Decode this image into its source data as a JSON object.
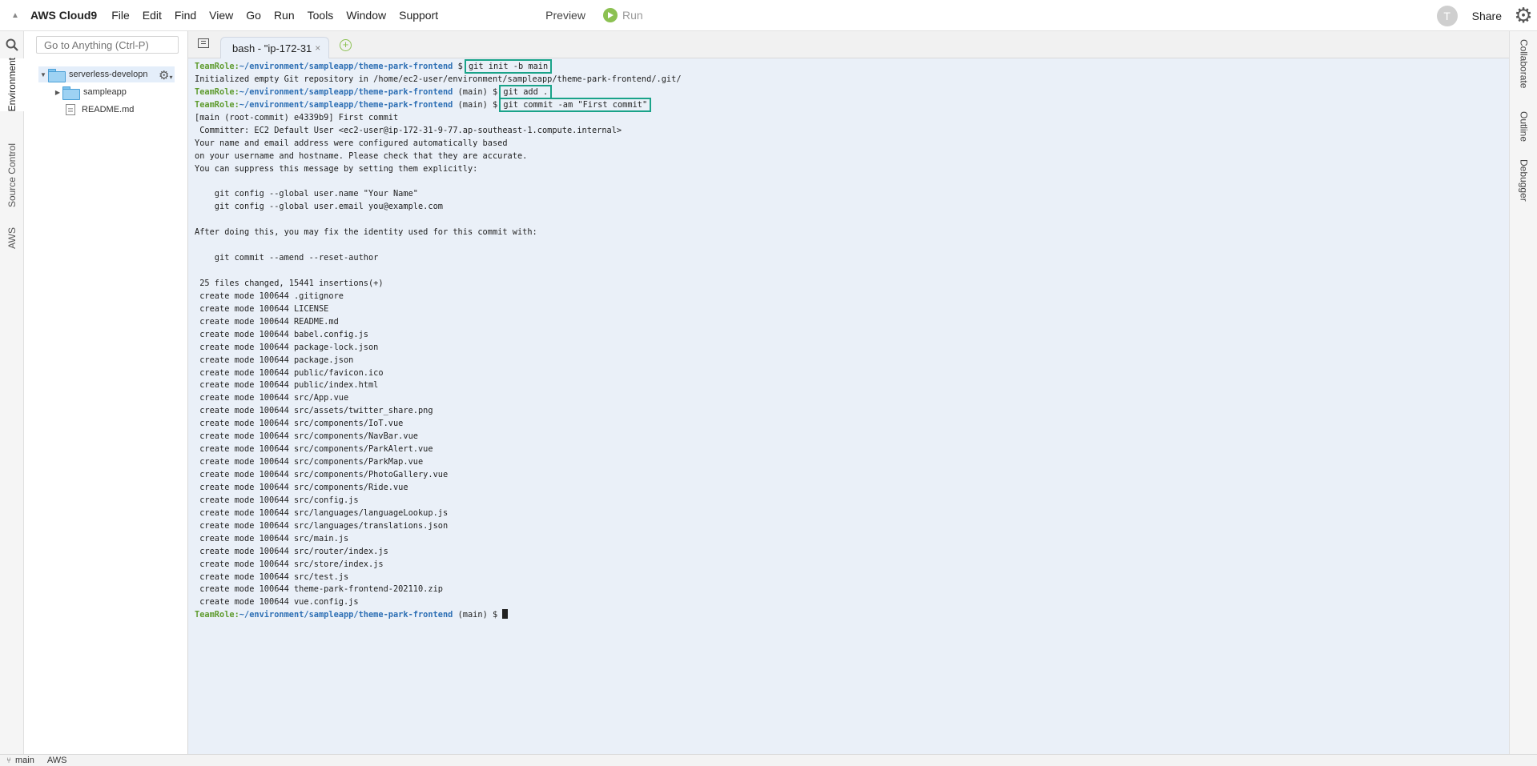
{
  "menubar": {
    "brand": "AWS Cloud9",
    "menus": [
      "File",
      "Edit",
      "Find",
      "View",
      "Go",
      "Run",
      "Tools",
      "Window",
      "Support"
    ],
    "preview": "Preview",
    "run": "Run",
    "avatar_letter": "T",
    "share": "Share"
  },
  "left_tabs": [
    "Environment",
    "Source Control",
    "AWS"
  ],
  "right_tabs": [
    "Collaborate",
    "Outline",
    "Debugger"
  ],
  "goto_placeholder": "Go to Anything (Ctrl-P)",
  "tree": {
    "root": "serverless-developn",
    "children": [
      {
        "name": "sampleapp",
        "type": "folder"
      },
      {
        "name": "README.md",
        "type": "file"
      }
    ]
  },
  "tab": {
    "label": "bash - \"ip-172-31",
    "close": "×"
  },
  "terminal": {
    "prompt_role": "TeamRole:",
    "prompt_path": "~/environment/sampleapp/theme-park-frontend",
    "lines": [
      {
        "kind": "prompt",
        "branch": "",
        "cmd": "git init -b main",
        "boxed": true
      },
      {
        "kind": "out",
        "text": "Initialized empty Git repository in /home/ec2-user/environment/sampleapp/theme-park-frontend/.git/"
      },
      {
        "kind": "prompt",
        "branch": " (main)",
        "cmd": "git add .",
        "boxed": true
      },
      {
        "kind": "prompt",
        "branch": " (main)",
        "cmd": "git commit -am \"First commit\"",
        "boxed": true
      },
      {
        "kind": "out",
        "text": "[main (root-commit) e4339b9] First commit"
      },
      {
        "kind": "out",
        "text": " Committer: EC2 Default User <ec2-user@ip-172-31-9-77.ap-southeast-1.compute.internal>"
      },
      {
        "kind": "out",
        "text": "Your name and email address were configured automatically based"
      },
      {
        "kind": "out",
        "text": "on your username and hostname. Please check that they are accurate."
      },
      {
        "kind": "out",
        "text": "You can suppress this message by setting them explicitly:"
      },
      {
        "kind": "out",
        "text": ""
      },
      {
        "kind": "out",
        "text": "    git config --global user.name \"Your Name\""
      },
      {
        "kind": "out",
        "text": "    git config --global user.email you@example.com"
      },
      {
        "kind": "out",
        "text": ""
      },
      {
        "kind": "out",
        "text": "After doing this, you may fix the identity used for this commit with:"
      },
      {
        "kind": "out",
        "text": ""
      },
      {
        "kind": "out",
        "text": "    git commit --amend --reset-author"
      },
      {
        "kind": "out",
        "text": ""
      },
      {
        "kind": "out",
        "text": " 25 files changed, 15441 insertions(+)"
      },
      {
        "kind": "out",
        "text": " create mode 100644 .gitignore"
      },
      {
        "kind": "out",
        "text": " create mode 100644 LICENSE"
      },
      {
        "kind": "out",
        "text": " create mode 100644 README.md"
      },
      {
        "kind": "out",
        "text": " create mode 100644 babel.config.js"
      },
      {
        "kind": "out",
        "text": " create mode 100644 package-lock.json"
      },
      {
        "kind": "out",
        "text": " create mode 100644 package.json"
      },
      {
        "kind": "out",
        "text": " create mode 100644 public/favicon.ico"
      },
      {
        "kind": "out",
        "text": " create mode 100644 public/index.html"
      },
      {
        "kind": "out",
        "text": " create mode 100644 src/App.vue"
      },
      {
        "kind": "out",
        "text": " create mode 100644 src/assets/twitter_share.png"
      },
      {
        "kind": "out",
        "text": " create mode 100644 src/components/IoT.vue"
      },
      {
        "kind": "out",
        "text": " create mode 100644 src/components/NavBar.vue"
      },
      {
        "kind": "out",
        "text": " create mode 100644 src/components/ParkAlert.vue"
      },
      {
        "kind": "out",
        "text": " create mode 100644 src/components/ParkMap.vue"
      },
      {
        "kind": "out",
        "text": " create mode 100644 src/components/PhotoGallery.vue"
      },
      {
        "kind": "out",
        "text": " create mode 100644 src/components/Ride.vue"
      },
      {
        "kind": "out",
        "text": " create mode 100644 src/config.js"
      },
      {
        "kind": "out",
        "text": " create mode 100644 src/languages/languageLookup.js"
      },
      {
        "kind": "out",
        "text": " create mode 100644 src/languages/translations.json"
      },
      {
        "kind": "out",
        "text": " create mode 100644 src/main.js"
      },
      {
        "kind": "out",
        "text": " create mode 100644 src/router/index.js"
      },
      {
        "kind": "out",
        "text": " create mode 100644 src/store/index.js"
      },
      {
        "kind": "out",
        "text": " create mode 100644 src/test.js"
      },
      {
        "kind": "out",
        "text": " create mode 100644 theme-park-frontend-202110.zip"
      },
      {
        "kind": "out",
        "text": " create mode 100644 vue.config.js"
      },
      {
        "kind": "prompt",
        "branch": " (main)",
        "cmd": "",
        "boxed": false,
        "cursor": true
      }
    ]
  },
  "statusbar": {
    "branch": "main",
    "aws": "AWS"
  },
  "colors": {
    "accent_box": "#1aa389",
    "prompt_role": "#5e9b2e",
    "prompt_path": "#2d6fb4",
    "terminal_bg": "#eaf0f8"
  }
}
